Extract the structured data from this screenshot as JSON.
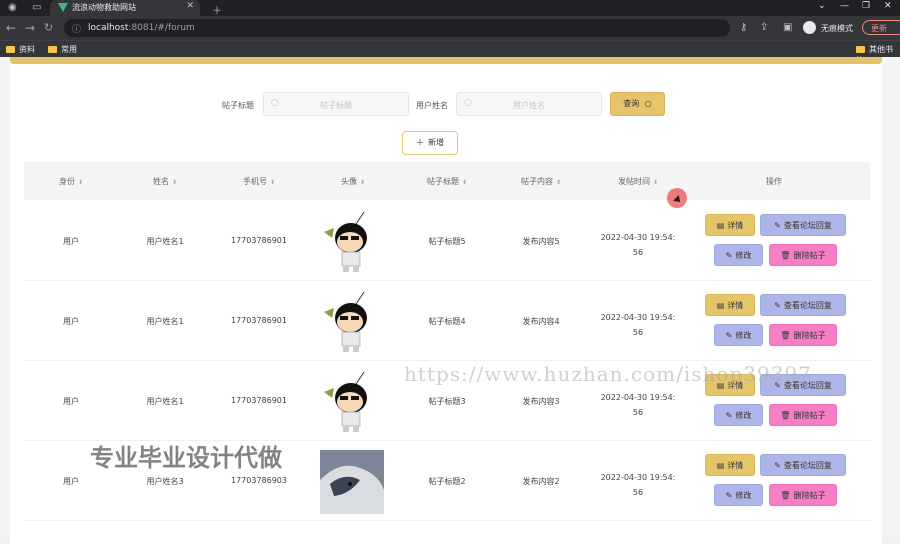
{
  "browser": {
    "tab_title": "流浪动物救助网站",
    "url_host": "localhost",
    "url_rest": ":8081/#/forum",
    "profile_label": "无痕模式",
    "update_label": "更新",
    "bookmarks": [
      "资料",
      "常用",
      "其他书签"
    ]
  },
  "search": {
    "title_label": "帖子标题",
    "title_placeholder": "帖子标题",
    "user_label": "用户姓名",
    "user_placeholder": "用户姓名",
    "query_button": "查询",
    "add_button": "新增"
  },
  "table": {
    "headers": [
      "身份",
      "姓名",
      "手机号",
      "头像",
      "帖子标题",
      "帖子内容",
      "发帖时间",
      "操作"
    ],
    "rows": [
      {
        "role": "用户",
        "name": "用户姓名1",
        "phone": "17703786901",
        "avatar": "cartoon",
        "title": "帖子标题5",
        "content": "发布内容5",
        "time1": "2022-04-30 19:54:",
        "time2": "56"
      },
      {
        "role": "用户",
        "name": "用户姓名1",
        "phone": "17703786901",
        "avatar": "cartoon",
        "title": "帖子标题4",
        "content": "发布内容4",
        "time1": "2022-04-30 19:54:",
        "time2": "56"
      },
      {
        "role": "用户",
        "name": "用户姓名1",
        "phone": "17703786901",
        "avatar": "cartoon",
        "title": "帖子标题3",
        "content": "发布内容3",
        "time1": "2022-04-30 19:54:",
        "time2": "56"
      },
      {
        "role": "用户",
        "name": "用户姓名3",
        "phone": "17703786903",
        "avatar": "husky",
        "title": "帖子标题2",
        "content": "发布内容2",
        "time1": "2022-04-30 19:54:",
        "time2": "56"
      }
    ],
    "actions": {
      "detail": "详情",
      "view_reply": "查看论坛回复",
      "edit": "修改",
      "delete": "删除帖子"
    }
  },
  "watermarks": {
    "url": "https://www.huzhan.com/ishop39397",
    "slogan": "专业毕业设计代做"
  },
  "colors": {
    "accent": "#e6c46a",
    "lavender": "#aeb6e8",
    "pink": "#f47fc4"
  }
}
